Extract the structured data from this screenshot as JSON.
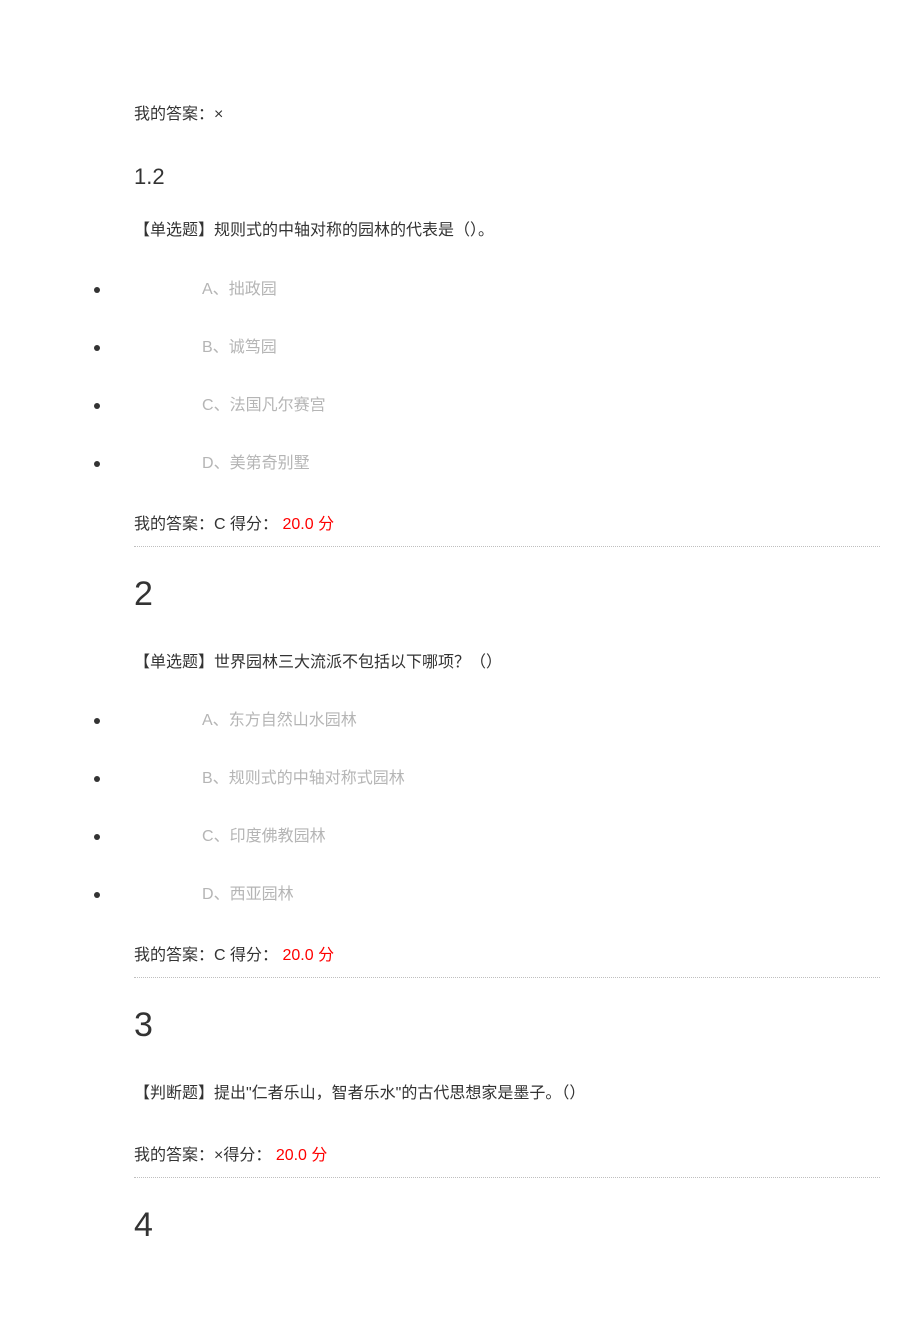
{
  "intro": {
    "my_answer_prefix": "我的答案：",
    "my_answer_value": "×"
  },
  "q12": {
    "number": "1.2",
    "text": "【单选题】规则式的中轴对称的园林的代表是（）。",
    "options": [
      {
        "label": "A",
        "sep": "、",
        "text": "拙政园"
      },
      {
        "label": "B",
        "sep": "、",
        "text": "诚笃园"
      },
      {
        "label": "C",
        "sep": "、",
        "text": "法国凡尔赛宫"
      },
      {
        "label": "D",
        "sep": "、",
        "text": "美第奇别墅"
      }
    ],
    "answer_prefix": "我的答案：",
    "answer_value": "C",
    "score_label": " 得分： ",
    "score_value": "20.0",
    "score_unit": " 分"
  },
  "q2": {
    "number": "2",
    "text": "【单选题】世界园林三大流派不包括以下哪项？（）",
    "options": [
      {
        "label": "A",
        "sep": "、",
        "text": "东方自然山水园林"
      },
      {
        "label": "B",
        "sep": "、",
        "text": "规则式的中轴对称式园林"
      },
      {
        "label": "C",
        "sep": "、",
        "text": "印度佛教园林"
      },
      {
        "label": "D",
        "sep": "、",
        "text": "西亚园林"
      }
    ],
    "answer_prefix": "我的答案：",
    "answer_value": "C",
    "score_label": " 得分： ",
    "score_value": "20.0",
    "score_unit": " 分"
  },
  "q3": {
    "number": "3",
    "text": "【判断题】提出\"仁者乐山，智者乐水\"的古代思想家是墨子。（）",
    "answer_prefix": "我的答案：",
    "answer_value": "×",
    "score_label": "得分： ",
    "score_value": "20.0",
    "score_unit": " 分"
  },
  "q4": {
    "number": "4"
  }
}
